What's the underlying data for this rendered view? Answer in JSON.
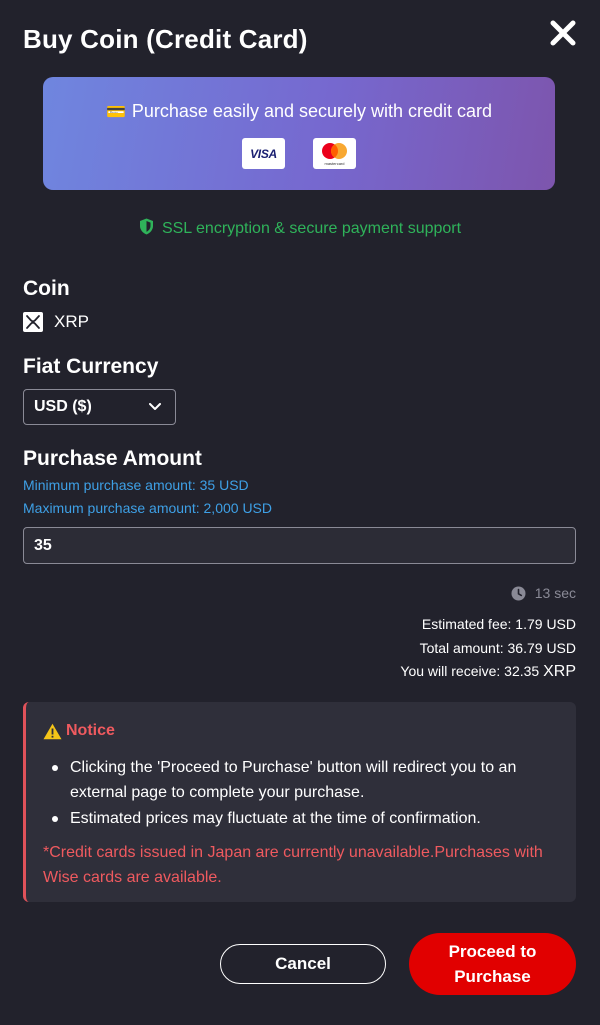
{
  "title": "Buy Coin (Credit Card)",
  "banner": {
    "text": "Purchase easily and securely with credit card",
    "card_brands": [
      "VISA",
      "mastercard"
    ]
  },
  "ssl_text": "SSL encryption & secure payment support",
  "coin": {
    "label": "Coin",
    "name": "XRP"
  },
  "fiat": {
    "label": "Fiat Currency",
    "selected": "USD ($)"
  },
  "purchase": {
    "label": "Purchase Amount",
    "min_text": "Minimum purchase amount: 35 USD",
    "max_text": "Maximum purchase amount: 2,000 USD",
    "amount_value": "35"
  },
  "timer": {
    "text": "13 sec"
  },
  "summary": {
    "fee": "Estimated fee: 1.79 USD",
    "total": "Total amount: 36.79 USD",
    "receive_prefix": "You will receive: 32.35 ",
    "receive_unit": "XRP"
  },
  "notice": {
    "title": "Notice",
    "items": [
      "Clicking the 'Proceed to Purchase' button will redirect you to an external page to complete your purchase.",
      "Estimated prices may fluctuate at the time of confirmation."
    ],
    "warning": "*Credit cards issued in Japan are currently unavailable.Purchases with Wise cards are available."
  },
  "buttons": {
    "cancel": "Cancel",
    "proceed": "Proceed to Purchase"
  },
  "colors": {
    "background": "#22222c",
    "accent_red": "#e10000",
    "ssl_green": "#2fb35a",
    "link_blue": "#3ea0e6",
    "notice_red": "#ef5a5f"
  },
  "icons": [
    "close-icon",
    "credit-card-icon",
    "shield-icon",
    "xrp-icon",
    "chevron-down-icon",
    "clock-icon",
    "warning-icon"
  ]
}
